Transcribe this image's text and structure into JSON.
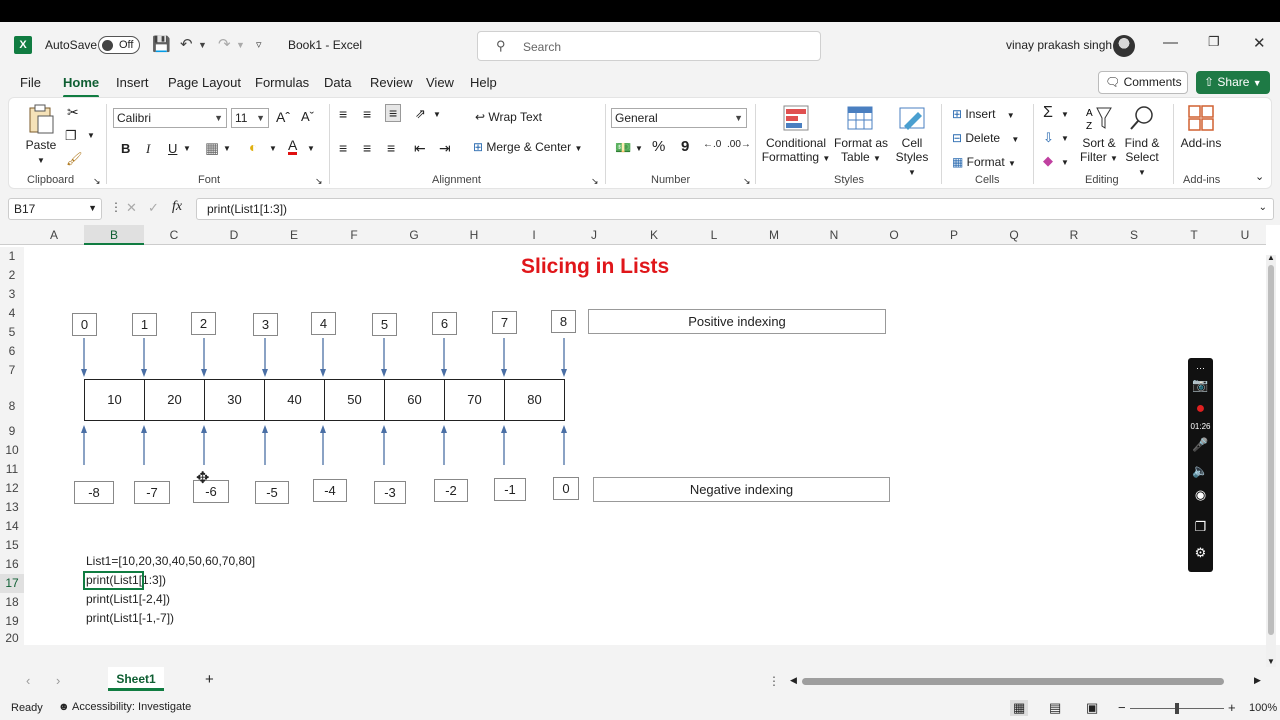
{
  "titlebar": {
    "autosave_label": "AutoSave",
    "autosave_state": "Off",
    "doc_title": "Book1  -  Excel",
    "search_placeholder": "Search",
    "user_name": "vinay prakash singh"
  },
  "menu": {
    "items": [
      "File",
      "Home",
      "Insert",
      "Page Layout",
      "Formulas",
      "Data",
      "Review",
      "View",
      "Help"
    ],
    "comments": "Comments",
    "share": "Share"
  },
  "ribbon": {
    "clipboard": {
      "paste": "Paste",
      "label": "Clipboard"
    },
    "font": {
      "name": "Calibri",
      "size": "11",
      "label": "Font",
      "bold": "B",
      "italic": "I",
      "underline": "U"
    },
    "alignment": {
      "wrap": "Wrap Text",
      "merge": "Merge & Center",
      "label": "Alignment"
    },
    "number": {
      "format": "General",
      "percent": "%",
      "comma": "9",
      "label": "Number"
    },
    "styles": {
      "conditional": [
        "Conditional",
        "Formatting"
      ],
      "format_table": [
        "Format as",
        "Table"
      ],
      "cell_styles": [
        "Cell",
        "Styles"
      ],
      "label": "Styles"
    },
    "cells": {
      "insert": "Insert",
      "delete": "Delete",
      "format": "Format",
      "label": "Cells"
    },
    "editing": {
      "sort": [
        "Sort &",
        "Filter"
      ],
      "find": [
        "Find &",
        "Select"
      ],
      "label": "Editing"
    },
    "addins": {
      "button": "Add-ins",
      "label": "Add-ins"
    }
  },
  "formula_bar": {
    "name_box": "B17",
    "fx": "fx",
    "formula": "print(List1[1:3])"
  },
  "columns": [
    "A",
    "B",
    "C",
    "D",
    "E",
    "F",
    "G",
    "H",
    "I",
    "J",
    "K",
    "L",
    "M",
    "N",
    "O",
    "P",
    "Q",
    "R",
    "S",
    "T",
    "U"
  ],
  "rows": [
    "1",
    "2",
    "3",
    "4",
    "5",
    "6",
    "7",
    "8",
    "9",
    "10",
    "11",
    "12",
    "13",
    "14",
    "15",
    "16",
    "17",
    "18",
    "19",
    "20"
  ],
  "sheet": {
    "title": "Slicing in Lists",
    "positive_indices": [
      "0",
      "1",
      "2",
      "3",
      "4",
      "5",
      "6",
      "7",
      "8"
    ],
    "values": [
      "10",
      "20",
      "30",
      "40",
      "50",
      "60",
      "70",
      "80"
    ],
    "negative_indices": [
      "-8",
      "-7",
      "-6",
      "-5",
      "-4",
      "-3",
      "-2",
      "-1",
      "0"
    ],
    "positive_label": "Positive indexing",
    "negative_label": "Negative indexing",
    "code_lines": [
      "List1=[10,20,30,40,50,60,70,80]",
      "print(List1[1:3])",
      "print(List1[-2,4])",
      "print(List1[-1,-7])"
    ]
  },
  "recorder": {
    "timer": "01:26"
  },
  "tabs": {
    "sheet": "Sheet1"
  },
  "status": {
    "ready": "Ready",
    "accessibility": "Accessibility: Investigate",
    "zoom": "100%"
  },
  "colors": {
    "excel_green": "#107c41",
    "title_red": "#e0161a",
    "arrow_blue": "#4a6fa5"
  }
}
